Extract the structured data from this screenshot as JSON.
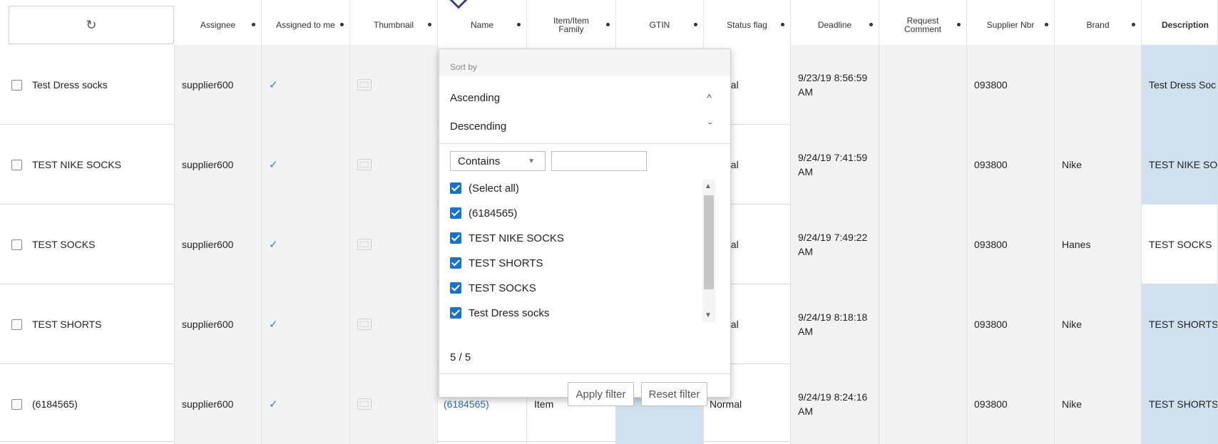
{
  "header": {
    "refresh_icon": "↻",
    "columns": [
      "Assignee",
      "Assigned to me",
      "Thumbnail",
      "Name",
      "Item/Item Family",
      "GTIN",
      "Status flag",
      "Deadline",
      "Request Comment",
      "Supplier Nbr",
      "Brand",
      "Description"
    ]
  },
  "rows": [
    {
      "name": "Test Dress socks",
      "assignee": "supplier600",
      "assigned": "✓",
      "status": "nal",
      "deadline": "9/23/19 8:56:59 AM",
      "supplier": "093800",
      "brand": "",
      "description": "Test Dress Soc"
    },
    {
      "name": "TEST NIKE SOCKS",
      "assignee": "supplier600",
      "assigned": "✓",
      "status": "nal",
      "deadline": "9/24/19 7:41:59 AM",
      "supplier": "093800",
      "brand": "Nike",
      "description": "TEST NIKE SOC"
    },
    {
      "name": "TEST SOCKS",
      "assignee": "supplier600",
      "assigned": "✓",
      "status": "nal",
      "deadline": "9/24/19 7:49:22 AM",
      "supplier": "093800",
      "brand": "Hanes",
      "description": "TEST SOCKS"
    },
    {
      "name": "TEST SHORTS",
      "assignee": "supplier600",
      "assigned": "✓",
      "status": "nal",
      "deadline": "9/24/19 8:18:18 AM",
      "supplier": "093800",
      "brand": "Nike",
      "description": "TEST SHORTS"
    },
    {
      "name": "(6184565)",
      "assignee": "supplier600",
      "assigned": "✓",
      "name_link": "(6184565)",
      "item_family": "Item",
      "status": "Normal",
      "deadline": "9/24/19 8:24:16 AM",
      "supplier": "093800",
      "brand": "Nike",
      "description": "TEST SHORTS"
    }
  ],
  "popup": {
    "sort_by": "Sort by",
    "ascending": "Ascending",
    "descending": "Descending",
    "asc_icon": "^",
    "desc_icon": "ˇ",
    "contains": "Contains",
    "filter_value": "",
    "items": [
      "(Select all)",
      "(6184565)",
      "TEST NIKE SOCKS",
      "TEST SHORTS",
      "TEST SOCKS",
      "Test Dress socks"
    ],
    "count": "5 / 5",
    "apply": "Apply filter",
    "reset": "Reset filter"
  },
  "colors": {
    "accent": "#1a73c8",
    "highlight": "#cfe0ef",
    "grey": "#f3f3f3"
  }
}
